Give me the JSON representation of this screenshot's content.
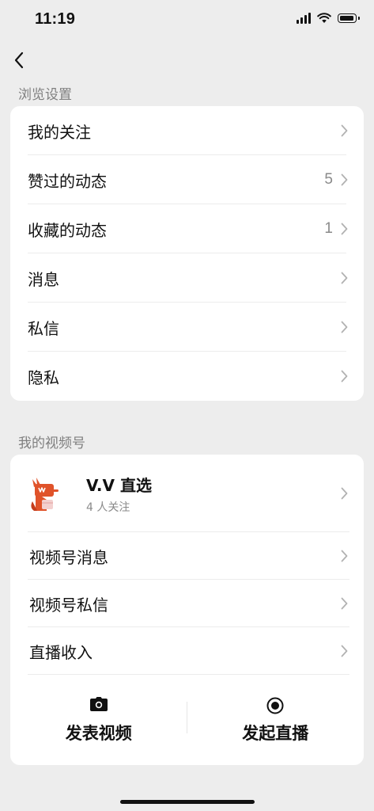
{
  "status_bar": {
    "time": "11:19"
  },
  "browse_section": {
    "title": "浏览设置",
    "items": [
      {
        "label": "我的关注",
        "count": ""
      },
      {
        "label": "赞过的动态",
        "count": "5"
      },
      {
        "label": "收藏的动态",
        "count": "1"
      },
      {
        "label": "消息",
        "count": ""
      },
      {
        "label": "私信",
        "count": ""
      },
      {
        "label": "隐私",
        "count": ""
      }
    ]
  },
  "channel_section": {
    "title": "我的视频号",
    "channel": {
      "name": "V.V 直选",
      "followers": "4 人关注"
    },
    "items": [
      {
        "label": "视频号消息"
      },
      {
        "label": "视频号私信"
      },
      {
        "label": "直播收入"
      }
    ],
    "actions": {
      "post_video": "发表视频",
      "start_live": "发起直播"
    }
  },
  "colors": {
    "background": "#ededed",
    "card": "#ffffff",
    "secondary_text": "#7f7f7f",
    "avatar_orange": "#e0532a"
  }
}
